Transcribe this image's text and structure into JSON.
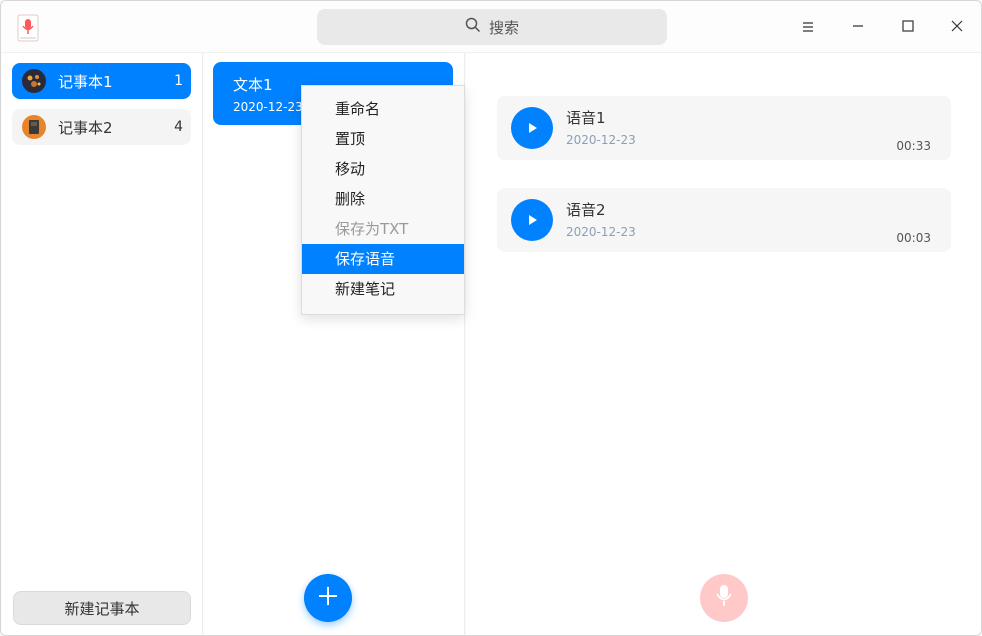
{
  "search": {
    "placeholder": "搜索",
    "icon": "search-icon"
  },
  "window_controls": {
    "menu_icon": "hamburger-icon",
    "minimize_icon": "minimize-icon",
    "maximize_icon": "maximize-icon",
    "close_icon": "close-icon"
  },
  "notebooks": {
    "items": [
      {
        "name": "记事本1",
        "count": "1",
        "active": true
      },
      {
        "name": "记事本2",
        "count": "4",
        "active": false
      }
    ],
    "new_button": "新建记事本"
  },
  "notes": {
    "items": [
      {
        "title": "文本1",
        "date": "2020-12-23"
      }
    ]
  },
  "context_menu": {
    "items": [
      {
        "label": "重命名",
        "state": "normal"
      },
      {
        "label": "置顶",
        "state": "normal"
      },
      {
        "label": "移动",
        "state": "normal"
      },
      {
        "label": "删除",
        "state": "normal"
      },
      {
        "label": "保存为TXT",
        "state": "disabled"
      },
      {
        "label": "保存语音",
        "state": "highlighted"
      },
      {
        "label": "新建笔记",
        "state": "normal"
      }
    ]
  },
  "voices": {
    "items": [
      {
        "title": "语音1",
        "date": "2020-12-23",
        "duration": "00:33"
      },
      {
        "title": "语音2",
        "date": "2020-12-23",
        "duration": "00:03"
      }
    ]
  },
  "colors": {
    "accent": "#0081ff",
    "record": "#ffc9c9"
  }
}
